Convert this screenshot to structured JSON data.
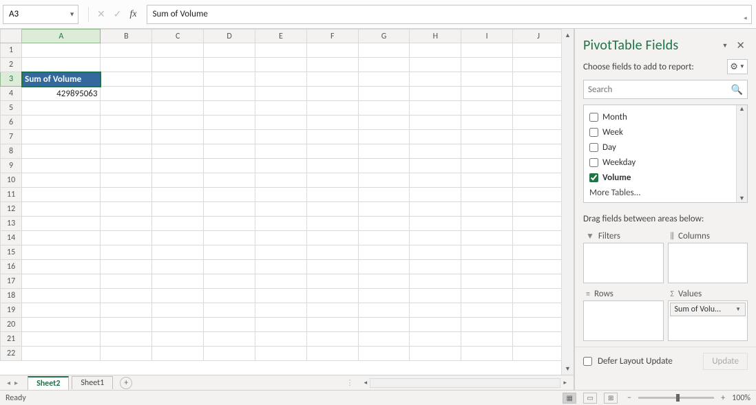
{
  "namebox": {
    "ref": "A3"
  },
  "formula": {
    "content": "Sum of Volume"
  },
  "columns": [
    "A",
    "B",
    "C",
    "D",
    "E",
    "F",
    "G",
    "H",
    "I",
    "J"
  ],
  "rows": [
    1,
    2,
    3,
    4,
    5,
    6,
    7,
    8,
    9,
    10,
    11,
    12,
    13,
    14,
    15,
    16,
    17,
    18,
    19,
    20,
    21,
    22
  ],
  "active_row": 3,
  "active_col": 0,
  "cells": {
    "r3c0": "Sum of Volume",
    "r4c0": "429895063"
  },
  "tabs": {
    "active": "Sheet2",
    "other": "Sheet1"
  },
  "pane": {
    "title": "PivotTable Fields",
    "choose": "Choose fields to add to report:",
    "search_placeholder": "Search",
    "fields": [
      {
        "name": "Month",
        "checked": false
      },
      {
        "name": "Week",
        "checked": false
      },
      {
        "name": "Day",
        "checked": false
      },
      {
        "name": "Weekday",
        "checked": false
      },
      {
        "name": "Volume",
        "checked": true
      }
    ],
    "more": "More Tables...",
    "drag": "Drag fields between areas below:",
    "areas": {
      "filters": "Filters",
      "columns": "Columns",
      "rows": "Rows",
      "values": "Values"
    },
    "value_item": "Sum of Volu...",
    "defer": "Defer Layout Update",
    "update": "Update"
  },
  "status": {
    "ready": "Ready",
    "zoom": "100%"
  }
}
